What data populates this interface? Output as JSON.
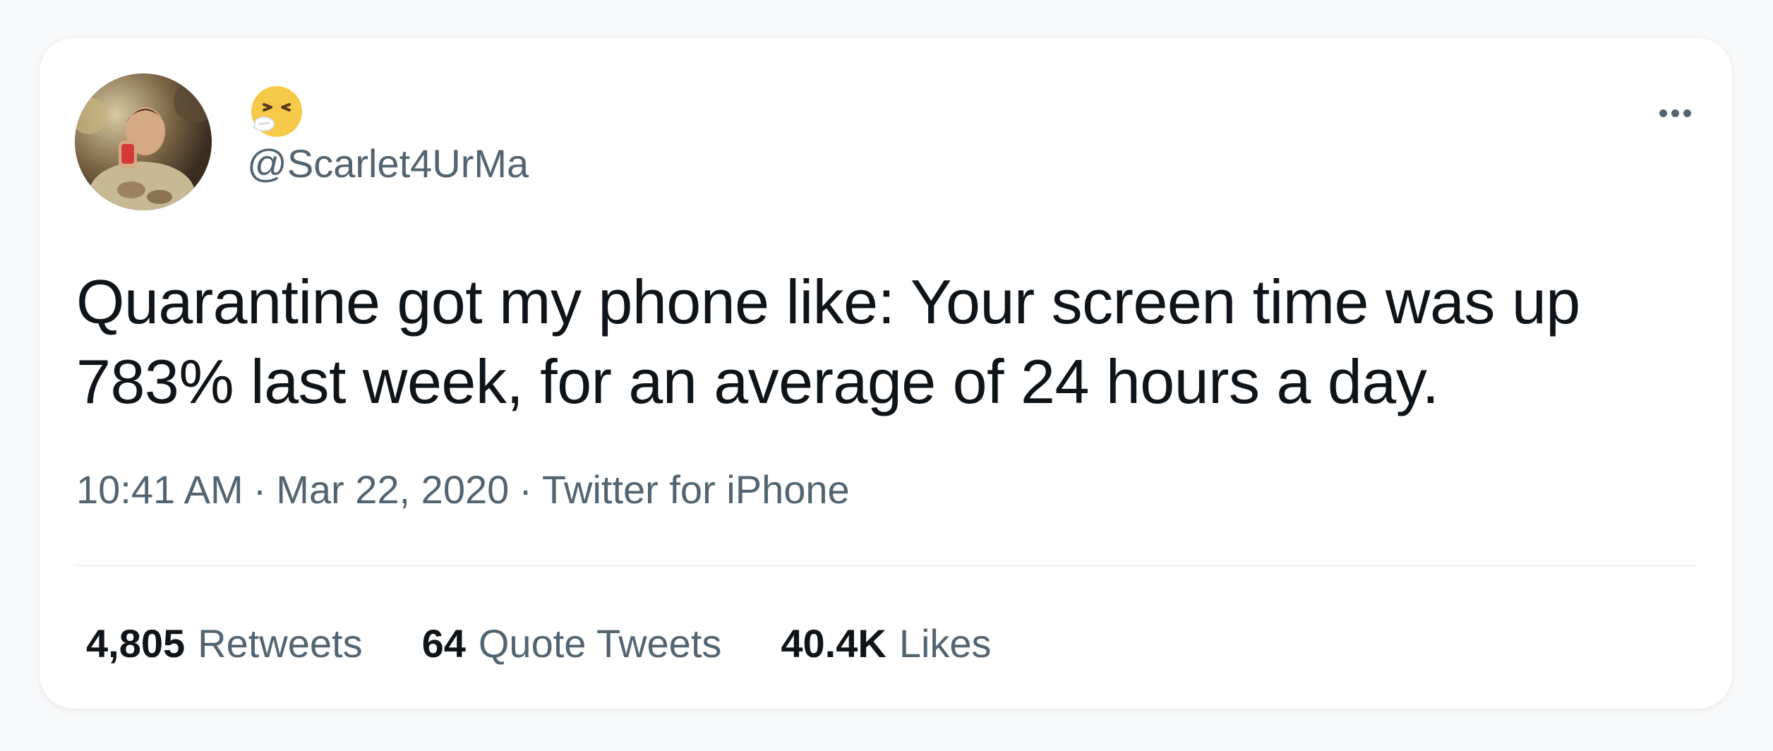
{
  "tweet": {
    "handle": "@Scarlet4UrMa",
    "display_name_icon": "sneezing-face-emoji",
    "text": "Quarantine got my phone like: Your screen time was up 783% last week, for an average of 24 hours a day.",
    "time": "10:41 AM",
    "date": "Mar 22, 2020",
    "source": "Twitter for iPhone",
    "separator": "·"
  },
  "stats": {
    "retweets_count": "4,805",
    "retweets_label": "Retweets",
    "quotes_count": "64",
    "quotes_label": "Quote Tweets",
    "likes_count": "40.4K",
    "likes_label": "Likes"
  },
  "colors": {
    "text_primary": "#0f1419",
    "text_secondary": "#536471",
    "background": "#f7f8f9",
    "card": "#ffffff",
    "divider": "#eff3f4"
  }
}
